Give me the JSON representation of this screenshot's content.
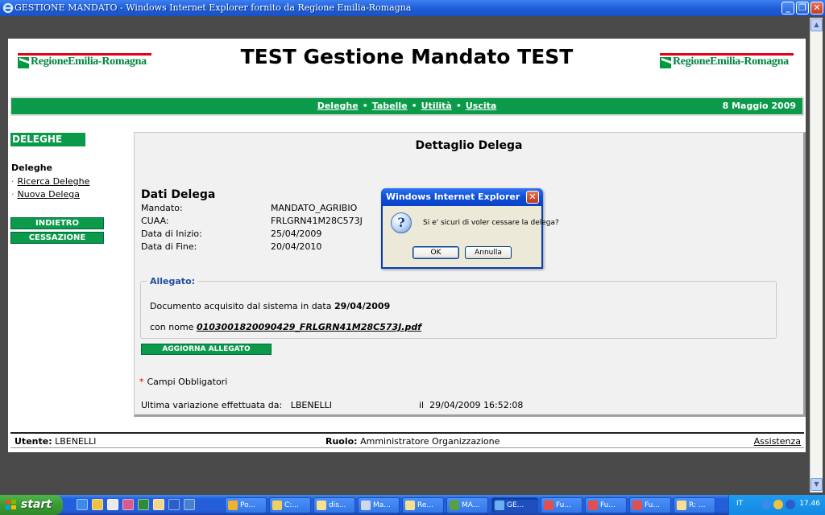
{
  "window": {
    "title": "GESTIONE MANDATO - Windows Internet Explorer fornito da Regione Emilia-Romagna"
  },
  "header": {
    "logo_text": "RegioneEmilia-Romagna",
    "title": "TEST Gestione Mandato TEST"
  },
  "nav": {
    "links": [
      "Deleghe",
      "Tabelle",
      "Utilità",
      "Uscita"
    ],
    "date": "8 Maggio 2009"
  },
  "sidebar": {
    "heading": "DELEGHE",
    "subheading": "Deleghe",
    "links": [
      "Ricerca Deleghe",
      "Nuova Delega"
    ],
    "buttons": [
      "INDIETRO",
      "CESSAZIONE"
    ]
  },
  "panel": {
    "title": "Dettaglio Delega",
    "section_title": "Dati Delega",
    "fields": [
      {
        "label": "Mandato:",
        "value": "MANDATO_AGRIBIO"
      },
      {
        "label": "CUAA:",
        "value": "FRLGRN41M28C573J"
      },
      {
        "label": "Data di Inizio:",
        "value": "25/04/2009"
      },
      {
        "label": "Data di Fine:",
        "value": "20/04/2010"
      }
    ],
    "allegato": {
      "legend": "Allegato:",
      "line1_prefix": "Documento acquisito dal sistema in data",
      "line1_date": "29/04/2009",
      "line2_prefix": "con nome",
      "file_name": "0103001820090429_FRLGRN41M28C573J.pdf"
    },
    "update_button": "AGGIORNA ALLEGATO",
    "required_star": "*",
    "required_text": "Campi Obbligatori",
    "last_change_label": "Ultima variazione effettuata da:",
    "last_change_user": "LBENELLI",
    "last_change_on": "il",
    "last_change_date": "29/04/2009 16:52:08"
  },
  "footer": {
    "user_label": "Utente:",
    "user_value": "LBENELLI",
    "role_label": "Ruolo:",
    "role_value": "Amministratore Organizzazione",
    "help_link": "Assistenza"
  },
  "dialog": {
    "title": "Windows Internet Explorer",
    "message": "Si e' sicuri di voler cessare la delega?",
    "ok_label": "OK",
    "cancel_label": "Annulla",
    "icon": "question-icon"
  },
  "taskbar": {
    "start_label": "start",
    "tasks": [
      "Po...",
      "C:...",
      "dis...",
      "Ma...",
      "Re...",
      "MA...",
      "GE...",
      "Fu...",
      "Fu...",
      "Fu...",
      "R: ..."
    ],
    "language": "IT",
    "clock": "17.46"
  },
  "colors": {
    "brand_green": "#0b9a4a",
    "xp_blue": "#245edb",
    "logo_red": "#e2001a"
  }
}
